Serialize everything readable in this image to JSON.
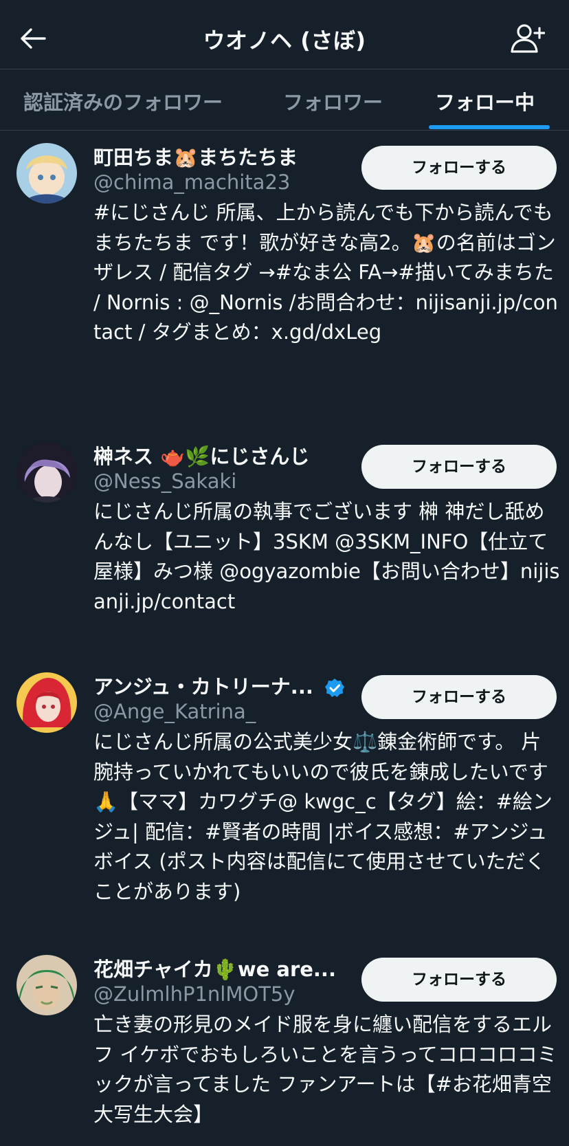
{
  "header": {
    "title": "ウオノヘ (さぼ)"
  },
  "tabs": [
    {
      "label": "認証済みのフォロワー",
      "active": false
    },
    {
      "label": "フォロワー",
      "active": false
    },
    {
      "label": "フォロー中",
      "active": true
    }
  ],
  "users": [
    {
      "name": "町田ちま🐹まちたちま",
      "handle": "@chima_machita23",
      "bio": "#にじさんじ 所属、上から読んでも下から読んでも まちたちま です！歌が好きな高2。🐹の名前はゴンザレス / 配信タグ →#なま公 FA→#描いてみまちた / Nornis : @_Nornis /お問合わせ：nijisanji.jp/contact / タグまとめ：x.gd/dxLeg",
      "follow_label": "フォローする",
      "verified": false,
      "avatar_colors": [
        "#cfe3f0",
        "#f3d9a4"
      ]
    },
    {
      "name": "榊ネス 🫖🌿にじさんじ",
      "handle": "@Ness_Sakaki",
      "bio": "にじさんじ所属の執事でございます 榊 神だし舐めんなし【ユニット】3SKM @3SKM_INFO【仕立て屋様】みつ様 @ogyazombie【お問い合わせ】nijisanji.jp/contact",
      "follow_label": "フォローする",
      "verified": false,
      "avatar_colors": [
        "#3d3550",
        "#9b86c6"
      ]
    },
    {
      "name": "アンジュ・カトリーナ...",
      "handle": "@Ange_Katrina_",
      "bio": "にじさんじ所属の公式美少女⚖️錬金術師です。 片腕持っていかれてもいいので彼氏を錬成したいです🙏【ママ】カワグチ@ kwgc_c【タグ】絵：#絵ンジュ| 配信：#賢者の時間 |ボイス感想：#アンジュボイス (ポスト内容は配信にて使用させていただくことがあります)",
      "follow_label": "フォローする",
      "verified": true,
      "avatar_colors": [
        "#f2c14e",
        "#d8283a"
      ]
    },
    {
      "name": "花畑チャイカ🌵we are...",
      "handle": "@ZulmlhP1nlMOT5y",
      "bio": "亡き妻の形見のメイド服を身に纏い配信をするエルフ イケボでおもしろいことを言うってコロコロコミックが言ってました ファンアートは【#お花畑青空大写生大会】",
      "follow_label": "フォローする",
      "verified": false,
      "avatar_colors": [
        "#3a7d44",
        "#c9b89a"
      ]
    }
  ]
}
